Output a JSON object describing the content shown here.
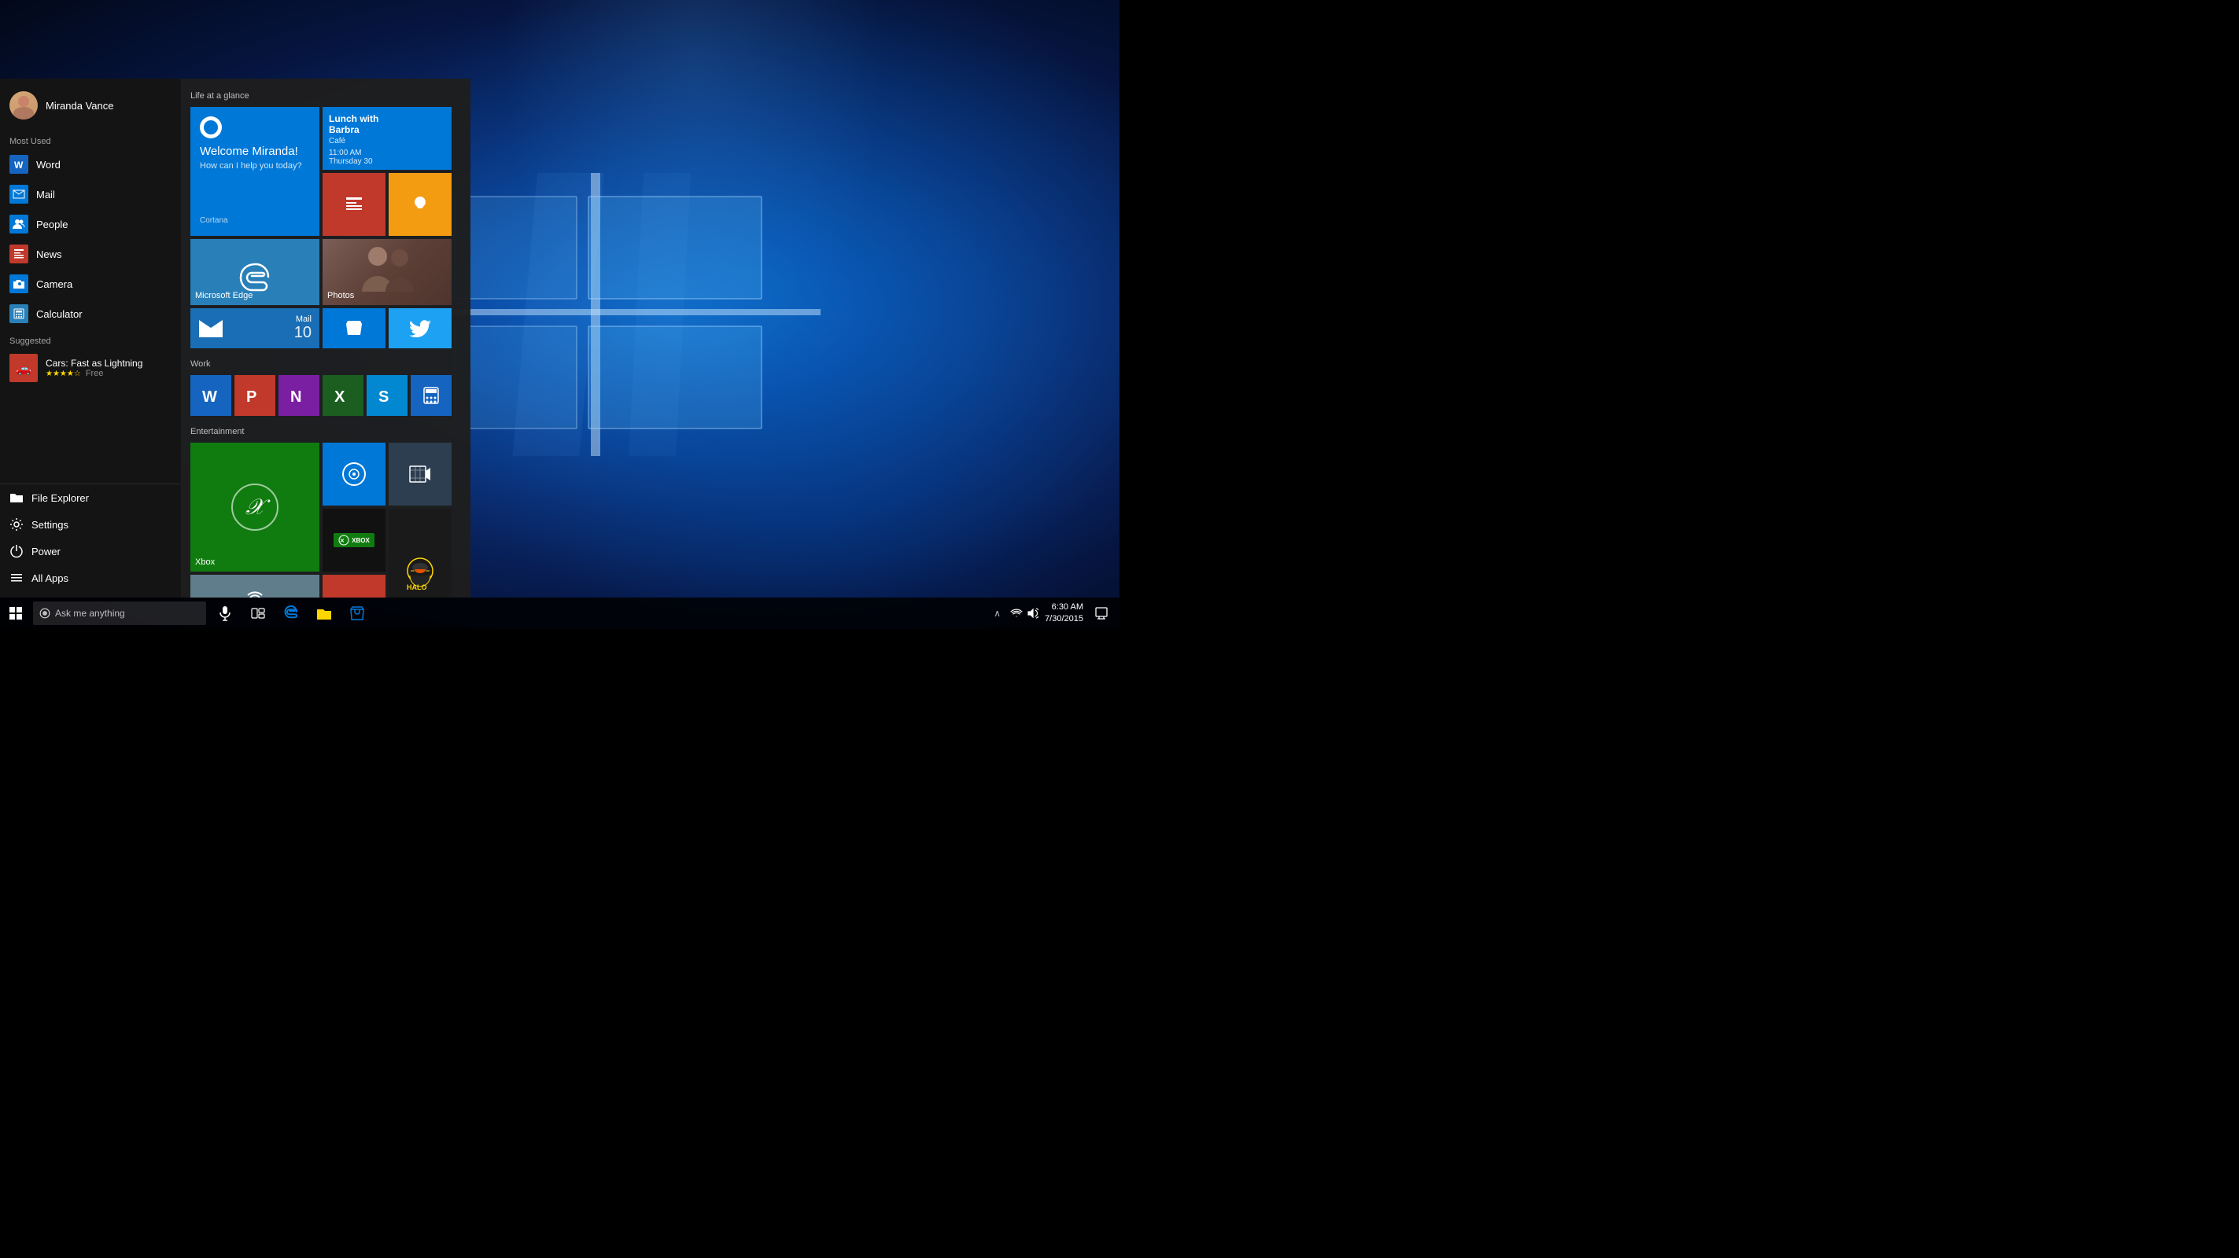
{
  "desktop": {
    "wallpaper_desc": "Windows 10 default blue wallpaper with Windows logo"
  },
  "start_menu": {
    "user_name": "Miranda Vance",
    "sections": {
      "most_used_label": "Most Used",
      "suggested_label": "Suggested"
    },
    "menu_items": [
      {
        "id": "word",
        "label": "Word",
        "icon_type": "word"
      },
      {
        "id": "mail",
        "label": "Mail",
        "icon_type": "mail"
      },
      {
        "id": "people",
        "label": "People",
        "icon_type": "people"
      },
      {
        "id": "news",
        "label": "News",
        "icon_type": "news"
      },
      {
        "id": "camera",
        "label": "Camera",
        "icon_type": "camera"
      },
      {
        "id": "calculator",
        "label": "Calculator",
        "icon_type": "calculator"
      }
    ],
    "suggested_apps": [
      {
        "id": "cars",
        "name": "Cars: Fast as Lightning",
        "badge": "Free",
        "stars": "★★★★☆"
      }
    ],
    "bottom_items": [
      {
        "id": "file-explorer",
        "label": "File Explorer",
        "icon": "📁"
      },
      {
        "id": "settings",
        "label": "Settings",
        "icon": "⚙"
      },
      {
        "id": "power",
        "label": "Power",
        "icon": "⏻"
      },
      {
        "id": "all-apps",
        "label": "All Apps",
        "icon": "≡"
      }
    ],
    "life_section": {
      "label": "Life at a glance",
      "cortana": {
        "welcome": "Welcome Miranda!",
        "subtitle": "How can I help you today?",
        "name": "Cortana"
      },
      "calendar": {
        "title": "Lunch with Barbra",
        "venue": "Café",
        "time": "11:00 AM",
        "day": "Thursday 30"
      },
      "tiles": [
        {
          "id": "news-tile",
          "label": ""
        },
        {
          "id": "tips-tile",
          "label": ""
        },
        {
          "id": "edge-tile",
          "label": "Microsoft Edge"
        },
        {
          "id": "photos-tile",
          "label": "Photos"
        },
        {
          "id": "mail-tile",
          "label": "Mail",
          "count": "10"
        },
        {
          "id": "store-tile",
          "label": ""
        },
        {
          "id": "twitter-tile",
          "label": ""
        }
      ]
    },
    "work_section": {
      "label": "Work",
      "tiles": [
        {
          "id": "wt-word",
          "label": "W",
          "color": "wt-word"
        },
        {
          "id": "wt-ppt",
          "label": "P",
          "color": "wt-ppt"
        },
        {
          "id": "wt-onenote",
          "label": "N",
          "color": "wt-onenote"
        },
        {
          "id": "wt-excel",
          "label": "X",
          "color": "wt-excel"
        },
        {
          "id": "wt-skype",
          "label": "S",
          "color": "wt-skype"
        },
        {
          "id": "wt-calc",
          "label": "=",
          "color": "wt-calc"
        }
      ]
    },
    "entertainment_section": {
      "label": "Entertainment",
      "xbox_label": "Xbox"
    }
  },
  "taskbar": {
    "search_placeholder": "Ask me anything",
    "time": "6:30 AM",
    "date": "7/30/2015"
  }
}
